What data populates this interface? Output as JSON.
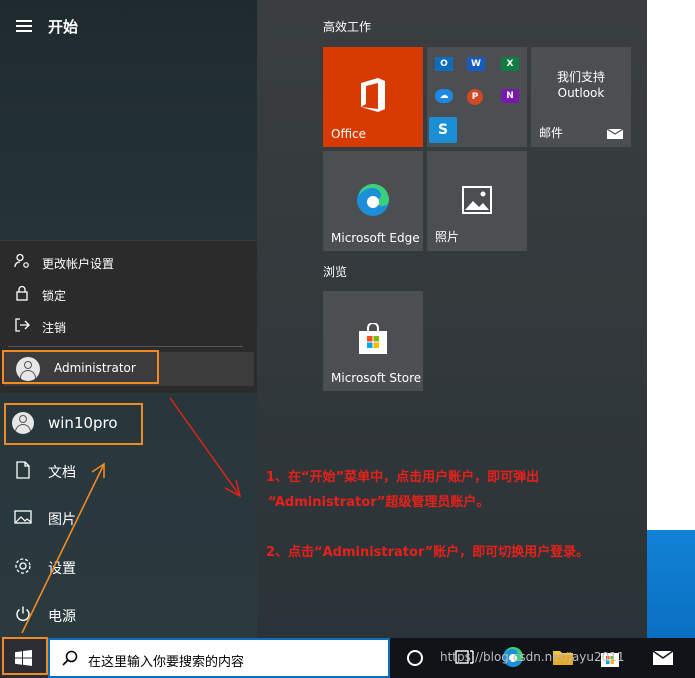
{
  "menu": {
    "title": "开始"
  },
  "flyout": {
    "items": [
      {
        "label": "更改帐户设置",
        "icon": "person-gear-icon"
      },
      {
        "label": "锁定",
        "icon": "lock-icon"
      },
      {
        "label": "注销",
        "icon": "sign-out-icon"
      }
    ],
    "account": "Administrator"
  },
  "left_items": {
    "user": "win10pro",
    "documents": "文档",
    "pictures": "图片",
    "settings": "设置",
    "power": "电源"
  },
  "tiles": {
    "group1": "高效工作",
    "group2": "浏览",
    "office": "Office",
    "mail_line1": "我们支持",
    "mail_line2": "Outlook",
    "mail": "邮件",
    "edge": "Microsoft Edge",
    "photos": "照片",
    "store": "Microsoft Store",
    "mini_apps": [
      "O",
      "W",
      "X",
      "☁",
      "P",
      "N",
      "S"
    ]
  },
  "annotations": {
    "line1": "1、在“开始”菜单中，点击用户账户，即可弹出",
    "line2": "“Administrator”超级管理员账户。",
    "line3": "2、点击“Administrator”账户，即可切换用户登录。"
  },
  "taskbar": {
    "search_placeholder": "在这里输入你要搜索的内容",
    "watermark": "https://blog.csdn.net/Jayu2011"
  },
  "colors": {
    "office_tile": "#d83b01",
    "highlight": "#f08a24",
    "annotation": "#e8201a"
  }
}
